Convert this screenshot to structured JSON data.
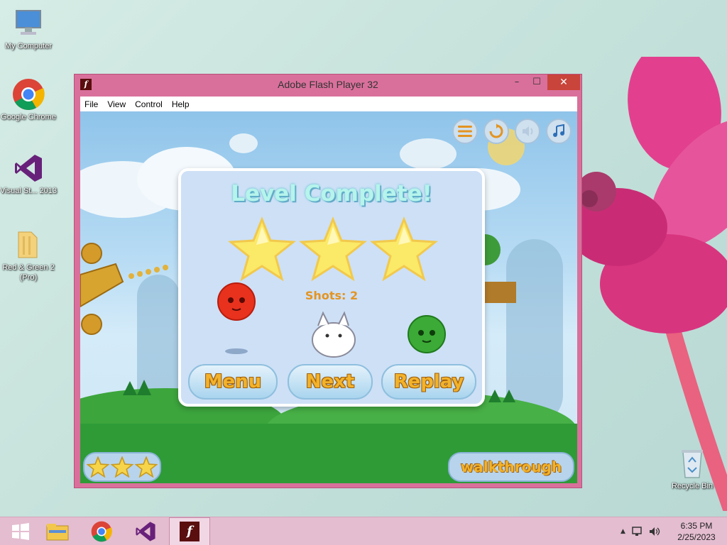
{
  "desktop": {
    "icons": [
      {
        "label": "My Computer"
      },
      {
        "label": "Google Chrome"
      },
      {
        "label": "Visual St... 2013"
      },
      {
        "label": "Red & Green 2 (Pro)"
      },
      {
        "label": "Recycle Bin"
      }
    ]
  },
  "window": {
    "title": "Adobe Flash Player 32",
    "app_icon": "f",
    "controls": {
      "minimize": "–",
      "maximize": "☐",
      "close": "✕"
    },
    "menu": [
      "File",
      "View",
      "Control",
      "Help"
    ]
  },
  "game": {
    "hud_icons": [
      "menu-icon",
      "restart-icon",
      "sound-icon",
      "music-icon"
    ],
    "dialog": {
      "heading": "Level Complete!",
      "stars_earned": 3,
      "shots": "Shots: 2",
      "buttons": {
        "menu": "Menu",
        "next": "Next",
        "replay": "Replay"
      }
    },
    "level_stars": 3,
    "walkthrough": "walkthrough"
  },
  "taskbar": {
    "items": [
      "start-icon",
      "file-explorer-icon",
      "chrome-icon",
      "visual-studio-icon",
      "flash-player-icon"
    ],
    "active_item": "flash-player-icon",
    "time": "6:35 PM",
    "date": "2/25/2023"
  },
  "colors": {
    "window_frame": "#d9709b",
    "close_button": "#c9443a",
    "dialog_bg": "#cde0f6",
    "button_text": "#f2b22a",
    "taskbar": "#e4bdd0"
  }
}
